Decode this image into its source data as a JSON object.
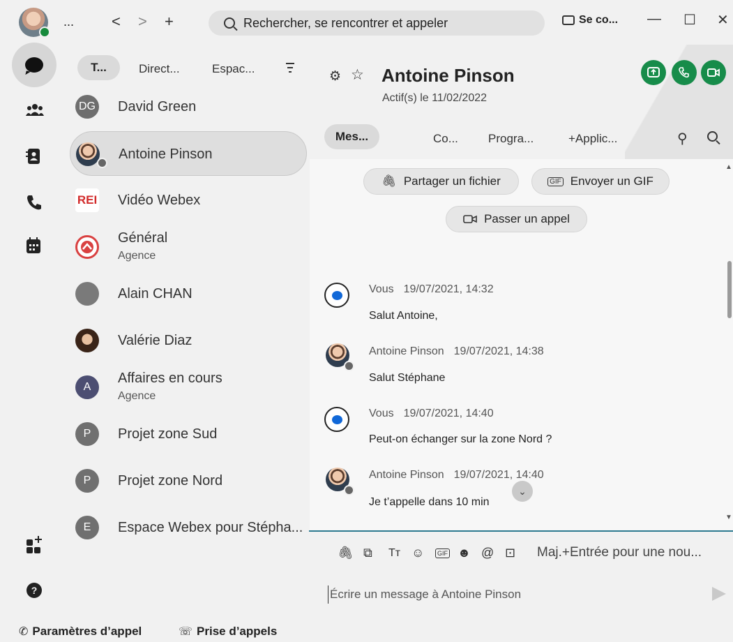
{
  "titlebar": {
    "more_label": "...",
    "back_label": "<",
    "forward_label": ">",
    "add_label": "+",
    "search_label": "Rechercher, se rencontrer et appeler",
    "connect_label": "Se co...",
    "minimize_label": "—",
    "maximize_label": "☐",
    "close_label": "✕"
  },
  "list": {
    "tabs": [
      "T...",
      "Direct...",
      "Espac..."
    ],
    "conversations": [
      {
        "initials": "DG",
        "name": "David Green",
        "sub": "",
        "color": "#6e6e6e"
      },
      {
        "initials": "",
        "name": "Antoine Pinson",
        "sub": "",
        "color": "#5a6b7c"
      },
      {
        "initials": "REI",
        "name": "Vidéo Webex",
        "sub": "",
        "color": "#d22b2b"
      },
      {
        "initials": "",
        "name": "Général",
        "sub": "Agence",
        "color": "#d94141"
      },
      {
        "initials": "",
        "name": "Alain CHAN",
        "sub": "",
        "color": "#7a7a7a"
      },
      {
        "initials": "",
        "name": "Valérie Diaz",
        "sub": "",
        "color": "#5b3a2b"
      },
      {
        "initials": "A",
        "name": "Affaires en cours",
        "sub": "Agence",
        "color": "#4c4e72"
      },
      {
        "initials": "P",
        "name": "Projet zone Sud",
        "sub": "",
        "color": "#707070"
      },
      {
        "initials": "P",
        "name": "Projet zone Nord",
        "sub": "",
        "color": "#707070"
      },
      {
        "initials": "E",
        "name": "Espace Webex pour Stépha...",
        "sub": "",
        "color": "#707070"
      }
    ]
  },
  "chat": {
    "title": "Antoine Pinson",
    "subtitle": "Actif(s) le 11/02/2022",
    "tabs": [
      "Mes...",
      "Co...",
      "Progra...",
      "+Applic..."
    ],
    "actions": {
      "share_file": "Partager un fichier",
      "send_gif": "Envoyer un GIF",
      "place_call": "Passer un appel"
    },
    "messages": [
      {
        "author": "Vous",
        "time": "19/07/2021, 14:32",
        "text": "Salut Antoine,",
        "self": true
      },
      {
        "author": "Antoine Pinson",
        "time": "19/07/2021, 14:38",
        "text": "Salut Stéphane",
        "self": false
      },
      {
        "author": "Vous",
        "time": "19/07/2021, 14:40",
        "text": "Peut-on échanger sur la zone Nord ?",
        "self": true
      },
      {
        "author": "Antoine Pinson",
        "time": "19/07/2021, 14:40",
        "text": "Je t’appelle dans 10 min",
        "self": false
      }
    ],
    "composer_hint": "Maj.+Entrée pour une nou...",
    "composer_placeholder": "Écrire un message à Antoine Pinson"
  },
  "footer": {
    "call_settings": "Paramètres d’appel",
    "call_pickup": "Prise d’appels"
  },
  "colors": {
    "accent_green": "#178c4a",
    "message_blue": "#1168d8",
    "divider": "#2c7a8f"
  }
}
